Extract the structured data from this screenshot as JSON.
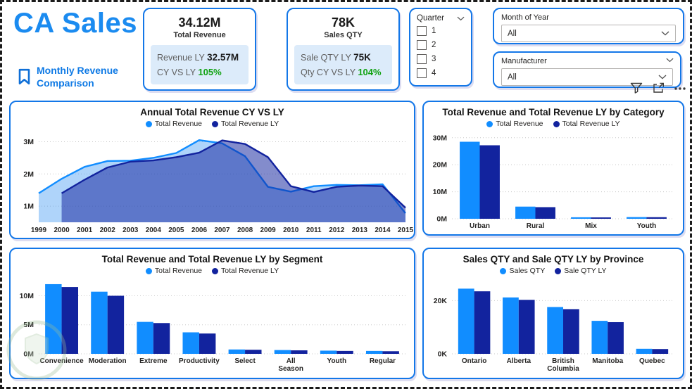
{
  "header": {
    "title": "CA Sales",
    "bookmark": {
      "line1": "Monthly Revenue",
      "line2": "Comparison"
    }
  },
  "kpis": [
    {
      "value": "34.12M",
      "label": "Total Revenue",
      "ly_label": "Revenue LY",
      "ly_value": "32.57M",
      "ratio_label": "CY VS LY",
      "ratio_value": "105%"
    },
    {
      "value": "78K",
      "label": "Sales QTY",
      "ly_label": "Sale QTY LY",
      "ly_value": "75K",
      "ratio_label": "Qty CY VS LY",
      "ratio_value": "104%"
    }
  ],
  "slicers": {
    "quarter": {
      "title": "Quarter",
      "items": [
        "1",
        "2",
        "3",
        "4"
      ]
    },
    "month": {
      "title": "Month of Year",
      "value": "All"
    },
    "manufacturer": {
      "title": "Manufacturer",
      "value": "All"
    }
  },
  "toolbar": {
    "icons": [
      "filter",
      "focus-mode",
      "more-options"
    ]
  },
  "colors": {
    "accent": "#1377e8",
    "title_blue": "#1b8bf0",
    "series1": "#118DFF",
    "series2": "#12239E",
    "series1_fill": "rgba(77,160,245,0.45)",
    "series2_fill": "rgba(18,35,158,0.52)",
    "green": "#12a212",
    "grid": "#c8c8c8"
  },
  "chart_data": [
    {
      "type": "area",
      "title": "Annual Total Revenue CY VS LY",
      "x": [
        1999,
        2000,
        2001,
        2002,
        2003,
        2004,
        2005,
        2006,
        2007,
        2008,
        2009,
        2010,
        2011,
        2012,
        2013,
        2014,
        2015
      ],
      "series": [
        {
          "name": "Total Revenue",
          "values": [
            1.4,
            1.85,
            2.22,
            2.4,
            2.41,
            2.5,
            2.65,
            3.05,
            2.95,
            2.55,
            1.6,
            1.45,
            1.62,
            1.66,
            1.65,
            1.68,
            0.78
          ]
        },
        {
          "name": "Total Revenue LY",
          "values": [
            null,
            1.4,
            1.82,
            2.2,
            2.38,
            2.42,
            2.52,
            2.66,
            3.04,
            2.93,
            2.52,
            1.62,
            1.44,
            1.6,
            1.64,
            1.62,
            0.95
          ]
        }
      ],
      "unit": "M",
      "yticks": [
        1,
        2,
        3
      ],
      "ymin": 0.5,
      "ymax": 3.25,
      "xlabel": "",
      "ylabel": "",
      "grid": true,
      "legend_position": "top"
    },
    {
      "type": "bar",
      "title": "Total Revenue and Total Revenue LY by Category",
      "categories": [
        "Urban",
        "Rural",
        "Mix",
        "Youth"
      ],
      "series": [
        {
          "name": "Total Revenue",
          "values": [
            28.5,
            4.5,
            0.55,
            0.62
          ]
        },
        {
          "name": "Total Revenue LY",
          "values": [
            27.2,
            4.3,
            0.5,
            0.58
          ]
        }
      ],
      "unit": "M",
      "yticks": [
        0,
        10,
        20,
        30
      ],
      "ymin": 0,
      "ymax": 31.5,
      "xlabel": "",
      "ylabel": "",
      "grid": true,
      "legend_position": "top"
    },
    {
      "type": "bar",
      "title": "Total Revenue and Total Revenue LY by Segment",
      "categories": [
        "Convenience",
        "Moderation",
        "Extreme",
        "Productivity",
        "Select",
        "All Season",
        "Youth",
        "Regular"
      ],
      "series": [
        {
          "name": "Total Revenue",
          "values": [
            12.0,
            10.7,
            5.5,
            3.7,
            0.75,
            0.65,
            0.55,
            0.5
          ]
        },
        {
          "name": "Total Revenue LY",
          "values": [
            11.5,
            10.0,
            5.3,
            3.5,
            0.7,
            0.6,
            0.5,
            0.45
          ]
        }
      ],
      "unit": "M",
      "yticks": [
        0,
        5,
        10
      ],
      "ymin": 0,
      "ymax": 12.6,
      "xlabel": "",
      "ylabel": "",
      "grid": true,
      "legend_position": "top"
    },
    {
      "type": "bar",
      "title": "Sales QTY and Sale QTY LY by Province",
      "categories": [
        "Ontario",
        "Alberta",
        "British Columbia",
        "Manitoba",
        "Quebec"
      ],
      "series": [
        {
          "name": "Sales QTY",
          "values": [
            24.5,
            21.2,
            17.6,
            12.4,
            1.9
          ]
        },
        {
          "name": "Sale QTY LY",
          "values": [
            23.5,
            20.3,
            16.8,
            11.9,
            1.8
          ]
        }
      ],
      "unit": "K",
      "yticks": [
        0,
        20
      ],
      "ymin": 0,
      "ymax": 27.5,
      "xlabel": "",
      "ylabel": "",
      "grid": true,
      "legend_position": "top"
    }
  ]
}
